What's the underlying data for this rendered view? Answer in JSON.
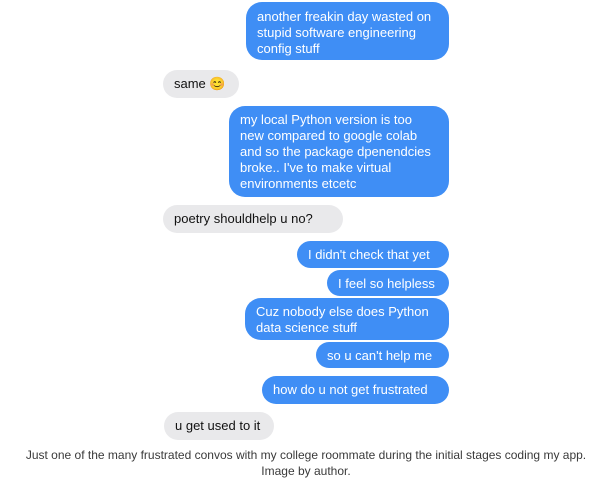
{
  "messages": [
    {
      "side": "sent",
      "text": "another freakin day wasted on\nstupid software engineering\nconfig stuff"
    },
    {
      "side": "received",
      "text": "same 😊"
    },
    {
      "side": "sent",
      "text": "my local Python version is too\nnew compared to google colab\nand so the package dpenendcies\nbroke.. I've to make virtual\nenvironments etcetc"
    },
    {
      "side": "received",
      "text": "poetry shouldhelp u no?"
    },
    {
      "side": "sent",
      "text": "I didn't check that yet"
    },
    {
      "side": "sent",
      "text": "I feel so helpless"
    },
    {
      "side": "sent",
      "text": "Cuz nobody else does Python\ndata science stuff"
    },
    {
      "side": "sent",
      "text": "so u can't help me"
    },
    {
      "side": "sent",
      "text": "how do u not get frustrated"
    },
    {
      "side": "received",
      "text": "u get used to it"
    }
  ],
  "caption": {
    "line1": "Just one of the many frustrated convos with my college roommate during the initial stages coding my app.",
    "line2": "Image by author."
  },
  "colors": {
    "sent_bubble": "#3f8ef5",
    "received_bubble": "#e9e9eb",
    "sent_text": "#ffffff",
    "received_text": "#111111"
  }
}
